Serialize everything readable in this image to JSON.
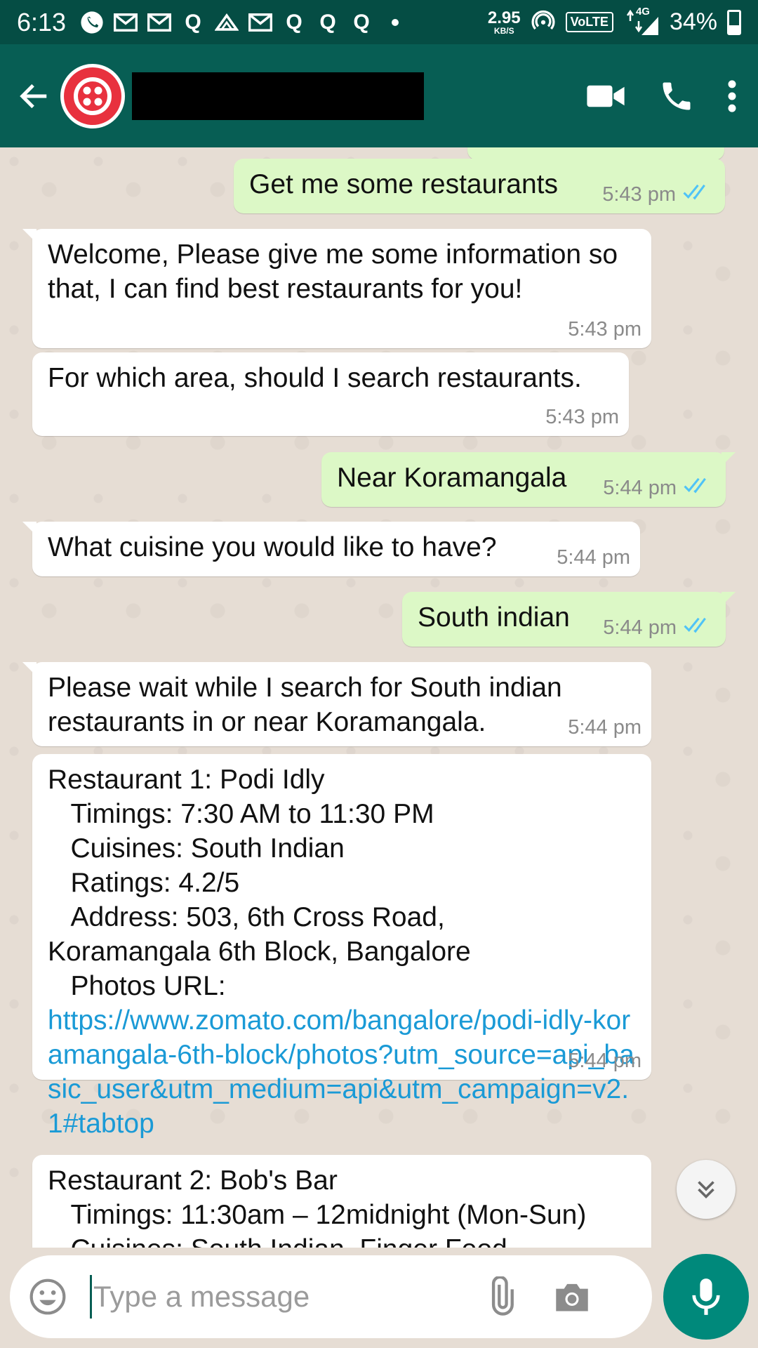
{
  "status_bar": {
    "time": "6:13",
    "net_speed_value": "2.95",
    "net_speed_unit": "KB/S",
    "volte": "VoLTE",
    "network": "4G",
    "battery": "34%",
    "battery_level": 0.34,
    "icons": [
      "whatsapp-icon",
      "gmail-icon",
      "gmail-icon",
      "quora-icon",
      "cloud-icon",
      "gmail-icon",
      "quora-icon",
      "quora-icon",
      "quora-icon",
      "dot-icon"
    ]
  },
  "app_bar": {
    "back_icon": "arrow-left-icon",
    "avatar_icon": "twilio-logo-icon",
    "video_icon": "video-call-icon",
    "call_icon": "phone-icon",
    "menu_icon": "more-vertical-icon"
  },
  "messages": [
    {
      "direction": "out",
      "text": "Get me some restaurants",
      "time": "5:43 pm",
      "read": true
    },
    {
      "direction": "in",
      "text": "Welcome, Please give me some information so that, I can find best restaurants for you!",
      "time": "5:43 pm"
    },
    {
      "direction": "in",
      "text": "For which area, should I search restaurants.",
      "time": "5:43 pm"
    },
    {
      "direction": "out",
      "text": "Near Koramangala",
      "time": "5:44 pm",
      "read": true
    },
    {
      "direction": "in",
      "text": "What cuisine you would like to have?",
      "time": "5:44 pm"
    },
    {
      "direction": "out",
      "text": "South indian",
      "time": "5:44 pm",
      "read": true
    },
    {
      "direction": "in",
      "text": "Please wait while I search for South indian restaurants in or near Koramangala.",
      "time": "5:44 pm"
    },
    {
      "direction": "in",
      "lines": [
        "Restaurant 1: Podi Idly",
        "   Timings: 7:30 AM to 11:30 PM",
        "   Cuisines: South Indian",
        "   Ratings: 4.2/5",
        "   Address: 503, 6th Cross Road,",
        "Koramangala 6th Block, Bangalore",
        "   Photos URL:"
      ],
      "link": "https://www.zomato.com/bangalore/podi-idly-koramangala-6th-block/photos?utm_source=api_basic_user&utm_medium=api&utm_campaign=v2.1#tabtop",
      "time": "5:44 pm"
    },
    {
      "direction": "in",
      "lines": [
        "Restaurant 2: Bob's Bar",
        "   Timings: 11:30am – 12midnight (Mon-Sun)",
        "   Cuisines: South Indian, Finger Food"
      ]
    }
  ],
  "input": {
    "placeholder": "Type a message",
    "emoji_icon": "emoji-icon",
    "attach_icon": "paperclip-icon",
    "camera_icon": "camera-icon",
    "mic_icon": "mic-icon",
    "scroll_icon": "chevron-double-down-icon"
  },
  "colors": {
    "status_bar": "#054d44",
    "app_bar": "#075e54",
    "outgoing_bubble": "#dcf8c6",
    "incoming_bubble": "#ffffff",
    "link": "#1a9ad6",
    "read_ticks": "#4fc3f7",
    "mic_button": "#00897b"
  }
}
